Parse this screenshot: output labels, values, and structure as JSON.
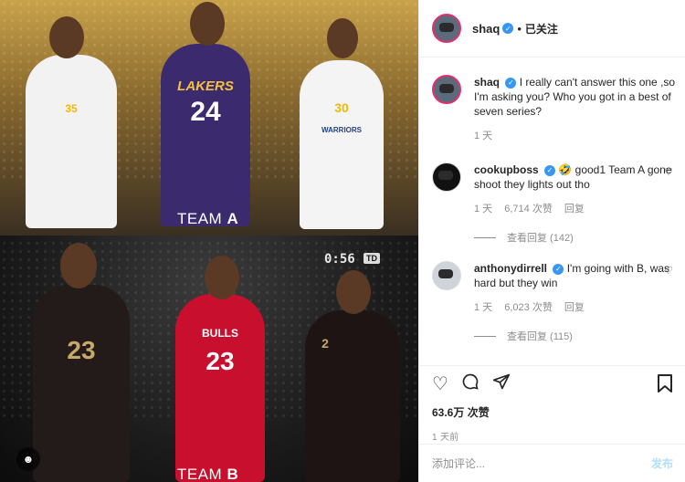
{
  "image": {
    "team_a_label": "TEAM",
    "team_a_letter": "A",
    "team_b_label": "TEAM",
    "team_b_letter": "B",
    "clock": "0:56",
    "clock_tag": "TD",
    "jerseys": {
      "p1": "35",
      "p2": "24",
      "p2_team": "LAKERS",
      "p3": "30",
      "p3_team": "WARRIORS",
      "p4": "23",
      "p5": "23",
      "p5_team": "BULLS",
      "p6": "2"
    }
  },
  "header": {
    "username": "shaq",
    "verified_mark": "✓",
    "separator": "•",
    "follow_status": "已关注"
  },
  "caption": {
    "username": "shaq",
    "text": "I really can't answer this one ,so I'm asking you? Who you got in a best of seven series?",
    "time": "1 天"
  },
  "comments": [
    {
      "username": "cookupboss",
      "text": "🤣 good1 Team A gone shoot they lights out tho",
      "time": "1 天",
      "likes": "6,714 次赞",
      "reply": "回复",
      "view_replies": "查看回复 (142)"
    },
    {
      "username": "anthonydirrell",
      "text": "I'm going with B, was hard but they win",
      "time": "1 天",
      "likes": "6,023 次赞",
      "reply": "回复",
      "view_replies": "查看回复 (115)"
    }
  ],
  "actions": {
    "likes": "63.6万 次赞",
    "time": "1 天前"
  },
  "add_comment": {
    "placeholder": "添加评论...",
    "post_label": "发布"
  },
  "colors": {
    "verified": "#3897f0",
    "story_ring": "#e1306c",
    "post_disabled": "#b2dffc"
  }
}
